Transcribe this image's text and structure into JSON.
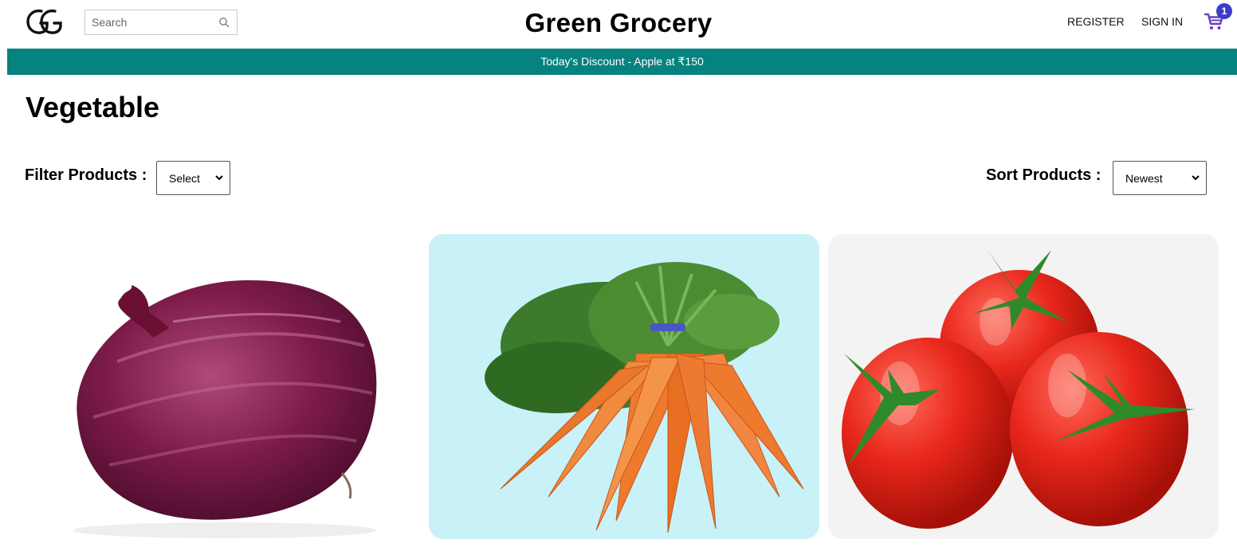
{
  "header": {
    "logo_text": "GG",
    "search_placeholder": "Search",
    "brand": "Green Grocery",
    "register_label": "REGISTER",
    "signin_label": "SIGN IN",
    "cart_count": "1",
    "cart_icon": "cart-icon",
    "search_icon": "search-icon"
  },
  "banner": {
    "text": "Today's Discount - Apple at ₹150"
  },
  "page": {
    "title": "Vegetable"
  },
  "controls": {
    "filter_label": "Filter Products :",
    "filter_value": "Select",
    "sort_label": "Sort Products :",
    "sort_value": "Newest"
  },
  "products": [
    {
      "name": "onion",
      "image": "onion-image",
      "background": "#ffffff"
    },
    {
      "name": "carrot",
      "image": "carrot-image",
      "background": "#c8f1f8"
    },
    {
      "name": "tomato",
      "image": "tomato-image",
      "background": "#f3f3f3"
    }
  ],
  "colors": {
    "banner": "#06827f",
    "cart_badge": "#3f3bc9",
    "cart_icon": "#6b3fc0"
  }
}
